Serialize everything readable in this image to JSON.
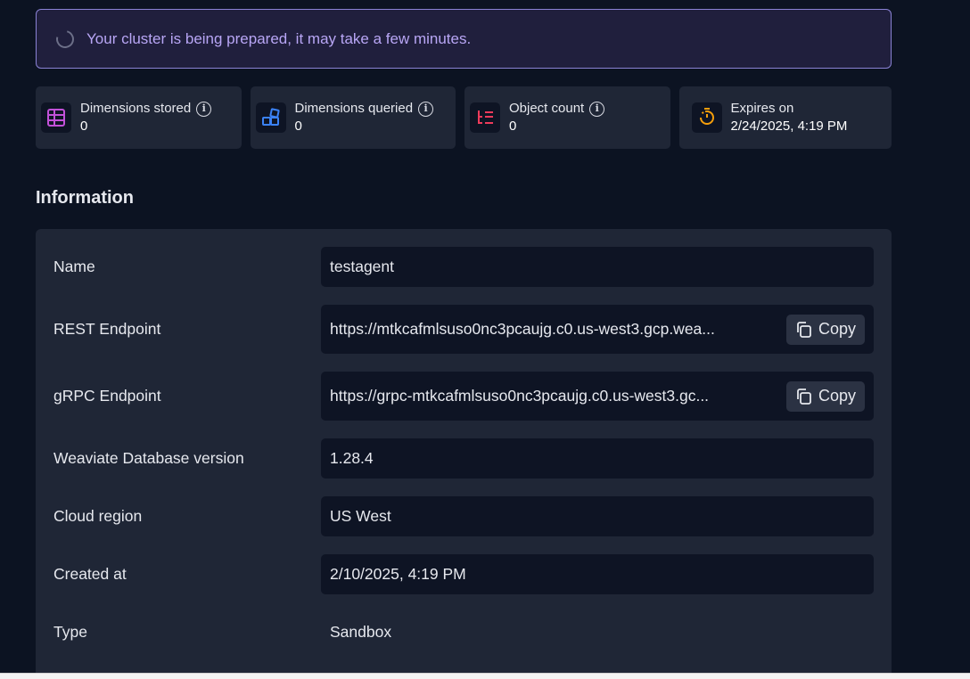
{
  "banner": {
    "message": "Your cluster is being prepared, it may take a few minutes.",
    "icon": "spinner-icon"
  },
  "stats": [
    {
      "label": "Dimensions stored",
      "value": "0",
      "icon": "grid-table-icon",
      "color": "#c251d8",
      "info": true
    },
    {
      "label": "Dimensions queried",
      "value": "0",
      "icon": "blocks-icon",
      "color": "#3b82f6",
      "info": true
    },
    {
      "label": "Object count",
      "value": "0",
      "icon": "list-tree-icon",
      "color": "#ef3b5b",
      "info": true
    },
    {
      "label": "Expires on",
      "value": "2/24/2025, 4:19 PM",
      "icon": "timer-icon",
      "color": "#f59e0b",
      "info": false
    }
  ],
  "information": {
    "title": "Information",
    "rows": [
      {
        "label": "Name",
        "value": "testagent"
      },
      {
        "label": "REST Endpoint",
        "value": "https://mtkcafmlsuso0nc3pcaujg.c0.us-west3.gcp.wea...",
        "copy_label": "Copy"
      },
      {
        "label": "gRPC Endpoint",
        "value": "https://grpc-mtkcafmlsuso0nc3pcaujg.c0.us-west3.gc...",
        "copy_label": "Copy"
      },
      {
        "label": "Weaviate Database version",
        "value": "1.28.4"
      },
      {
        "label": "Cloud region",
        "value": "US West"
      },
      {
        "label": "Created at",
        "value": "2/10/2025, 4:19 PM"
      },
      {
        "label": "Type",
        "value": "Sandbox"
      }
    ]
  }
}
